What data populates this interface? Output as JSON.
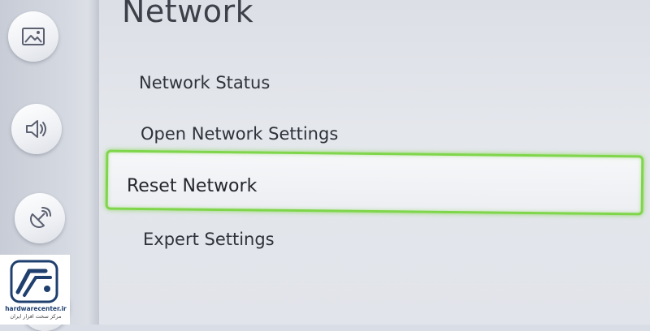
{
  "page": {
    "title": "Network"
  },
  "menu": {
    "items": [
      {
        "label": "Network Status"
      },
      {
        "label": "Open Network Settings"
      },
      {
        "label": "Reset Network",
        "selected": true
      },
      {
        "label": "Expert Settings"
      }
    ]
  },
  "sidebar": {
    "icons": [
      "picture-icon",
      "sound-icon",
      "broadcasting-icon",
      "general-icon"
    ]
  },
  "watermark": {
    "domain": "hardwarecenter.ir",
    "tagline": "مرکز سخت افزار ایران"
  },
  "colors": {
    "focus": "#7fd64a",
    "text": "#2f323a",
    "background": "#dcdfe6"
  }
}
